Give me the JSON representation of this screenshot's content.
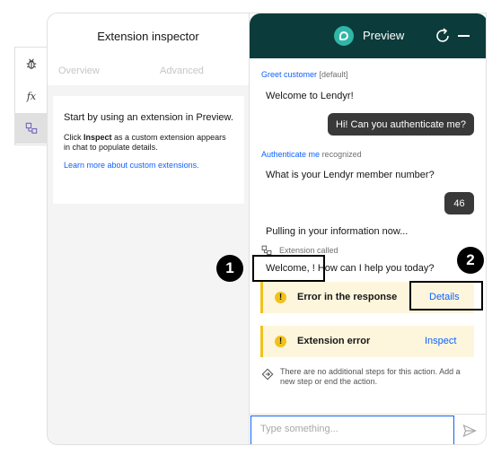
{
  "rail": {
    "items": [
      {
        "icon": "bug-icon"
      },
      {
        "icon": "function-icon",
        "glyph": "f𝑥"
      },
      {
        "icon": "extension-icon"
      }
    ]
  },
  "inspector": {
    "title": "Extension inspector",
    "tabs": [
      "Overview",
      "Advanced"
    ],
    "card": {
      "lead": "Start by using an extension in Preview.",
      "body_prefix": "Click ",
      "body_bold": "Inspect",
      "body_suffix": " as a custom extension appears in chat to populate details.",
      "link": "Learn more about custom extensions."
    }
  },
  "preview": {
    "title": "Preview",
    "messages": {
      "greet_action": "Greet customer",
      "greet_tag": "[default]",
      "welcome": "Welcome to Lendyr!",
      "user_1": "Hi! Can you authenticate me?",
      "auth_action": "Authenticate me",
      "auth_tag": "recognized",
      "member_q": "What is your Lendyr member number?",
      "user_2": "46",
      "pulling": "Pulling in your information now...",
      "extension_called": "Extension called",
      "welcome_back": "Welcome, ! How can I help you today?"
    },
    "alerts": [
      {
        "text": "Error in the response",
        "link": "Details"
      },
      {
        "text": "Extension error",
        "link": "Inspect"
      }
    ],
    "no_steps": "There are no additional steps for this action. Add a new step or end the action.",
    "composer": {
      "placeholder": "Type something..."
    }
  },
  "annotations": {
    "badge_1": "1",
    "badge_2": "2"
  },
  "colors": {
    "header_bg": "#0b3b3a",
    "accent": "#0f62fe",
    "warning": "#f1c21b",
    "warning_bg": "#fdf6dd",
    "user_bubble": "#393939"
  }
}
